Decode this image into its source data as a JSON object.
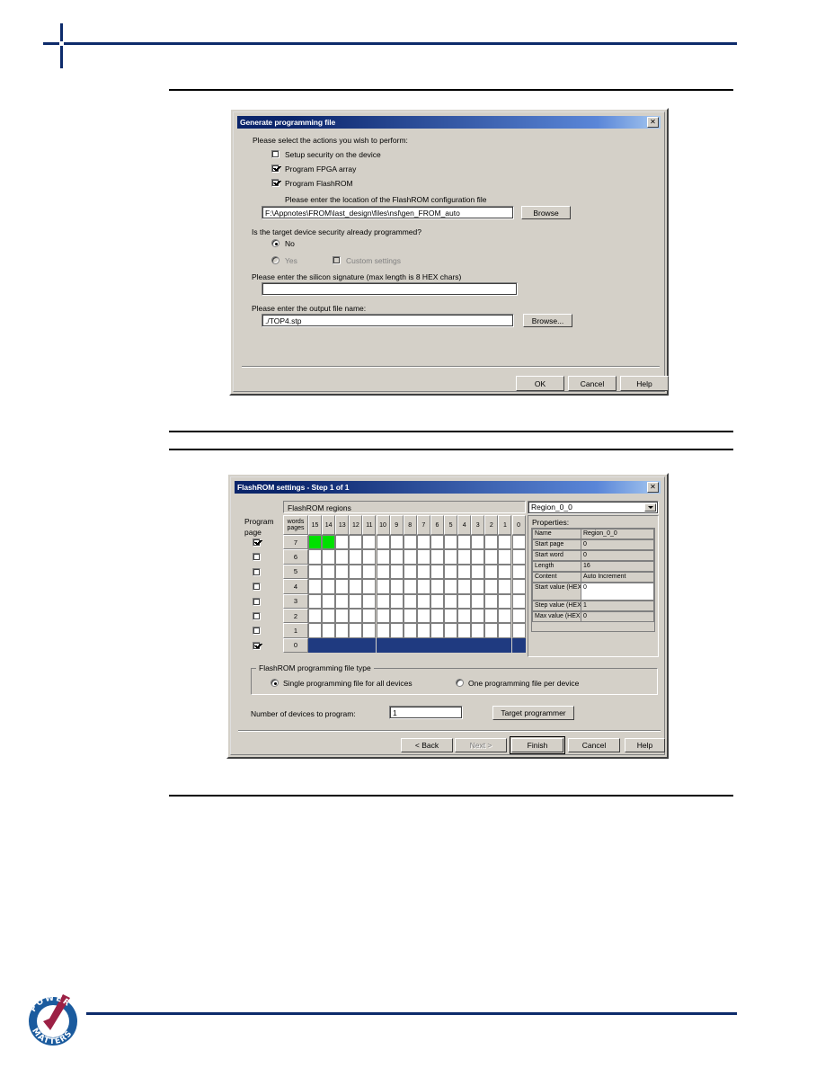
{
  "page": {
    "logo_text_top": "POWER",
    "logo_text_bottom": "MATTERS"
  },
  "dialog1": {
    "title": "Generate programming file",
    "close_button": "✕",
    "intro": "Please select the actions you wish to perform:",
    "checkboxes": [
      {
        "label": "Setup security on the device",
        "checked": false
      },
      {
        "label": "Program FPGA array",
        "checked": true
      },
      {
        "label": "Program FlashROM",
        "checked": true
      }
    ],
    "flashrom_config_label": "Please enter the location of the FlashROM configuration file",
    "flashrom_config_value": "F:\\Appnotes\\FROM\\last_design\\files\\nsl\\gen_FROM_auto",
    "browse1_label": "Browse",
    "security_question": "Is the target device security already programmed?",
    "radio_no": {
      "label": "No",
      "selected": true
    },
    "radio_yes": {
      "label": "Yes",
      "selected": false
    },
    "custom_settings": {
      "label": "Custom settings",
      "checked": false
    },
    "signature_label": "Please enter the silicon signature (max length is 8 HEX chars)",
    "signature_value": "",
    "outfile_label": "Please enter the output file name:",
    "outfile_value": "./TOP4.stp",
    "browse2_label": "Browse...",
    "buttons": {
      "ok": "OK",
      "cancel": "Cancel",
      "help": "Help"
    }
  },
  "dialog2": {
    "title": "FlashROM settings - Step 1 of 1",
    "close_button": "✕",
    "regions_label": "FlashROM regions",
    "region_select": "Region_0_0",
    "program_label_line1": "Program",
    "program_label_line2": "page",
    "corner_header_line1": "words",
    "corner_header_line2": "pages",
    "columns": [
      "15",
      "14",
      "13",
      "12",
      "11",
      "10",
      "9",
      "8",
      "7",
      "6",
      "5",
      "4",
      "3",
      "2",
      "1",
      "0"
    ],
    "rows": [
      {
        "page": "7",
        "program": true,
        "cells": [
          "green",
          "green",
          "",
          "",
          "",
          "",
          "",
          "",
          "",
          "",
          "",
          "",
          "",
          "",
          "",
          ""
        ]
      },
      {
        "page": "6",
        "program": false,
        "cells": [
          "",
          "",
          "",
          "",
          "",
          "",
          "",
          "",
          "",
          "",
          "",
          "",
          "",
          "",
          "",
          ""
        ]
      },
      {
        "page": "5",
        "program": false,
        "cells": [
          "",
          "",
          "",
          "",
          "",
          "",
          "",
          "",
          "",
          "",
          "",
          "",
          "",
          "",
          "",
          ""
        ]
      },
      {
        "page": "4",
        "program": false,
        "cells": [
          "",
          "",
          "",
          "",
          "",
          "",
          "",
          "",
          "",
          "",
          "",
          "",
          "",
          "",
          "",
          ""
        ]
      },
      {
        "page": "3",
        "program": false,
        "cells": [
          "",
          "",
          "",
          "",
          "",
          "",
          "",
          "",
          "",
          "",
          "",
          "",
          "",
          "",
          "",
          ""
        ]
      },
      {
        "page": "2",
        "program": false,
        "cells": [
          "",
          "",
          "",
          "",
          "",
          "",
          "",
          "",
          "",
          "",
          "",
          "",
          "",
          "",
          "",
          ""
        ]
      },
      {
        "page": "1",
        "program": false,
        "cells": [
          "",
          "",
          "",
          "",
          "",
          "",
          "",
          "",
          "",
          "",
          "",
          "",
          "",
          "",
          "",
          ""
        ]
      },
      {
        "page": "0",
        "program": true,
        "cells": [
          "navy",
          "navy",
          "navy",
          "navy",
          "navy",
          "navy",
          "navy",
          "navy",
          "navy",
          "navy",
          "navy",
          "navy",
          "navy",
          "navy",
          "navy",
          "navy"
        ]
      }
    ],
    "properties_label": "Properties:",
    "properties": [
      {
        "key": "Name",
        "value": "Region_0_0",
        "editable": false
      },
      {
        "key": "Start page",
        "value": "0",
        "editable": false
      },
      {
        "key": "Start word",
        "value": "0",
        "editable": false
      },
      {
        "key": "Length",
        "value": "16",
        "editable": false
      },
      {
        "key": "Content",
        "value": "Auto Increment",
        "editable": false
      },
      {
        "key": "Start value (HEX)",
        "value": "0",
        "editable": true
      },
      {
        "key": "Step value (HEX)",
        "value": "1",
        "editable": false
      },
      {
        "key": "Max value (HEX)",
        "value": "0",
        "editable": false
      }
    ],
    "filetype_group": "FlashROM programming file type",
    "radio_single": {
      "label": "Single programming file for all devices",
      "selected": true
    },
    "radio_perdev": {
      "label": "One programming file per device",
      "selected": false
    },
    "devices_label": "Number of devices to program:",
    "devices_value": "1",
    "target_programmer_label": "Target programmer",
    "buttons": {
      "back": "< Back",
      "next": "Next >",
      "finish": "Finish",
      "cancel": "Cancel",
      "help": "Help"
    }
  },
  "colors": {
    "brand_navy": "#0d2b6b",
    "title_blue": "#0a246a",
    "cell_green": "#00e000",
    "cell_navy": "#1f3a80",
    "face": "#d4d0c8"
  }
}
